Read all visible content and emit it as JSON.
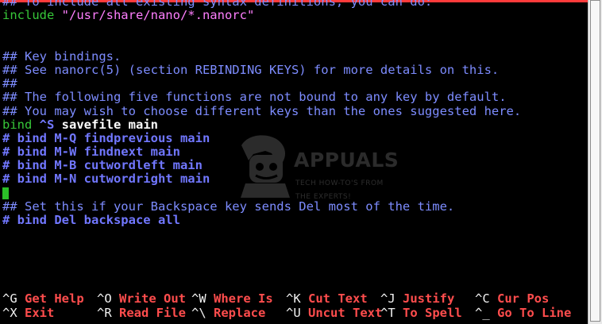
{
  "editor": {
    "lines": [
      [
        {
          "text": "## To include all existing syntax definitions, you can do:",
          "style": "comment"
        }
      ],
      [
        {
          "text": "include ",
          "style": "kw"
        },
        {
          "text": "\"/usr/share/nano/*.nanorc\"",
          "style": "str"
        }
      ],
      [
        {
          "text": "",
          "style": "plain"
        }
      ],
      [
        {
          "text": "",
          "style": "plain"
        }
      ],
      [
        {
          "text": "## Key bindings.",
          "style": "comment"
        }
      ],
      [
        {
          "text": "## See nanorc(5) (section REBINDING KEYS) for more details on this.",
          "style": "comment"
        }
      ],
      [
        {
          "text": "##",
          "style": "comment"
        }
      ],
      [
        {
          "text": "## The following five functions are not bound to any key by default.",
          "style": "comment"
        }
      ],
      [
        {
          "text": "## You may wish to choose different keys than the ones suggested here.",
          "style": "comment"
        }
      ],
      [
        {
          "text": "bind ",
          "style": "kw"
        },
        {
          "text": "^S",
          "style": "bold-blue"
        },
        {
          "text": " savefile main",
          "style": "bold-white"
        }
      ],
      [
        {
          "text": "# bind M-Q findprevious main",
          "style": "bold-blue"
        }
      ],
      [
        {
          "text": "# bind M-W findnext main",
          "style": "bold-blue"
        }
      ],
      [
        {
          "text": "# bind M-B cutwordleft main",
          "style": "bold-blue"
        }
      ],
      [
        {
          "text": "# bind M-N cutwordright main",
          "style": "bold-blue"
        }
      ],
      [
        {
          "text": "",
          "style": "cursor-line"
        }
      ],
      [
        {
          "text": "## Set this if your Backspace key sends Del most of the time.",
          "style": "comment"
        }
      ],
      [
        {
          "text": "# bind Del backspace all",
          "style": "bold-blue"
        }
      ]
    ]
  },
  "shortcuts": {
    "row1": [
      {
        "key": "^G",
        "label": "Get Help"
      },
      {
        "key": "^O",
        "label": "Write Out"
      },
      {
        "key": "^W",
        "label": "Where Is"
      },
      {
        "key": "^K",
        "label": "Cut Text"
      },
      {
        "key": "^J",
        "label": "Justify"
      },
      {
        "key": "^C",
        "label": "Cur Pos"
      }
    ],
    "row2": [
      {
        "key": "^X",
        "label": "Exit"
      },
      {
        "key": "^R",
        "label": "Read File"
      },
      {
        "key": "^\\",
        "label": "Replace"
      },
      {
        "key": "^U",
        "label": "Uncut Text"
      },
      {
        "key": "^T",
        "label": "To Spell"
      },
      {
        "key": "^_",
        "label": "Go To Line"
      }
    ]
  },
  "watermark": {
    "text": "APPUALS",
    "subtext": "TECH HOW-TO'S FROM THE EXPERTS!"
  },
  "colors": {
    "background": "#000000",
    "comment": "#7d8cff",
    "keyword": "#37c739",
    "string": "#ff7fff",
    "shortcut_label": "#ff4d4d",
    "cursor": "#2bbf28"
  }
}
